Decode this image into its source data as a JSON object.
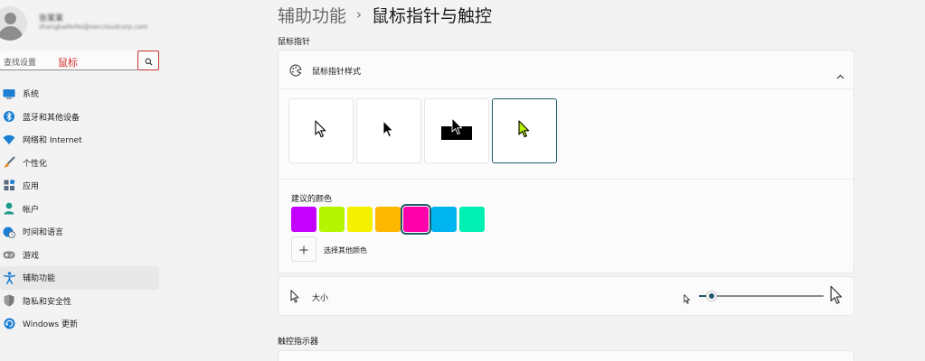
{
  "user": {
    "name": "张某某",
    "email": "zhangbaifeifei@oeccloudcorp.com"
  },
  "search": {
    "placeholder": "查找设置",
    "value": "鼠标",
    "icon": "search-icon"
  },
  "sidebar": {
    "items": [
      {
        "label": "系统",
        "icon": "monitor-icon",
        "color": "#1b7fd3"
      },
      {
        "label": "蓝牙和其他设备",
        "icon": "bluetooth-icon",
        "color": "#1b7fd3"
      },
      {
        "label": "网络和 Internet",
        "icon": "wifi-icon",
        "color": "#1b7fd3"
      },
      {
        "label": "个性化",
        "icon": "paintbrush-icon",
        "color": "#e0912b"
      },
      {
        "label": "应用",
        "icon": "apps-icon",
        "color": "#5a6b80"
      },
      {
        "label": "帐户",
        "icon": "person-icon",
        "color": "#1f9a88"
      },
      {
        "label": "时间和语言",
        "icon": "globe-clock-icon",
        "color": "#1b7fd3"
      },
      {
        "label": "游戏",
        "icon": "gamepad-icon",
        "color": "#707070"
      },
      {
        "label": "辅助功能",
        "icon": "accessibility-icon",
        "color": "#1b7fd3",
        "active": true
      },
      {
        "label": "隐私和安全性",
        "icon": "shield-icon",
        "color": "#707070"
      },
      {
        "label": "Windows 更新",
        "icon": "update-icon",
        "color": "#1b7fd3"
      }
    ]
  },
  "breadcrumb": {
    "parent": "辅助功能",
    "separator": "›",
    "current": "鼠标指针与触控"
  },
  "mouse_pointer_section": {
    "title": "鼠标指针",
    "style_card": {
      "label": "鼠标指针样式",
      "icon": "pointer-palette-icon",
      "expanded": true,
      "styles": [
        {
          "name": "white",
          "icon": "cursor-white-icon"
        },
        {
          "name": "black",
          "icon": "cursor-black-icon"
        },
        {
          "name": "inverted",
          "icon": "cursor-inverted-icon"
        },
        {
          "name": "custom",
          "icon": "cursor-custom-icon",
          "selected": true
        }
      ]
    },
    "recommended_colors": {
      "label": "建议的颜色",
      "colors": [
        "#c400ff",
        "#b6f500",
        "#f5f200",
        "#ffb800",
        "#ff00aa",
        "#00b4f0",
        "#00f0b4"
      ],
      "selected_index": 4
    },
    "custom_color": {
      "label": "选择其他颜色"
    },
    "size": {
      "label": "大小",
      "level": 0.1,
      "accent": "#1f5a68"
    }
  },
  "touch_section": {
    "title": "触控指示器"
  }
}
